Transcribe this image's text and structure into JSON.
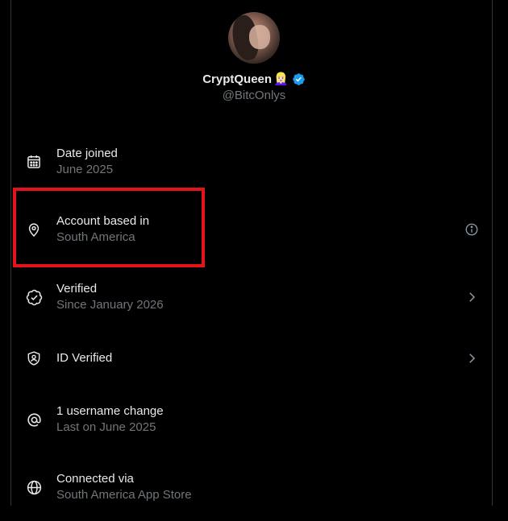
{
  "profile": {
    "display_name": "CryptQueen",
    "emoji": "👱🏻‍♀️",
    "handle": "@BitcOnlys",
    "verified_color": "#1d9bf0"
  },
  "rows": [
    {
      "icon": "calendar-icon",
      "label": "Date joined",
      "sub": "June 2025",
      "trailing": ""
    },
    {
      "icon": "location-pin-icon",
      "label": "Account based in",
      "sub": "South America",
      "trailing": "info-icon"
    },
    {
      "icon": "verified-badge-icon",
      "label": "Verified",
      "sub": "Since January 2026",
      "trailing": "chevron-right-icon"
    },
    {
      "icon": "id-shield-icon",
      "label": "ID Verified",
      "sub": "",
      "trailing": "chevron-right-icon"
    },
    {
      "icon": "at-sign-icon",
      "label": "1 username change",
      "sub": "Last on June 2025",
      "trailing": ""
    },
    {
      "icon": "globe-icon",
      "label": "Connected via",
      "sub": "South America App Store",
      "trailing": ""
    }
  ],
  "annotation": {
    "highlight_color": "#e3121b"
  }
}
